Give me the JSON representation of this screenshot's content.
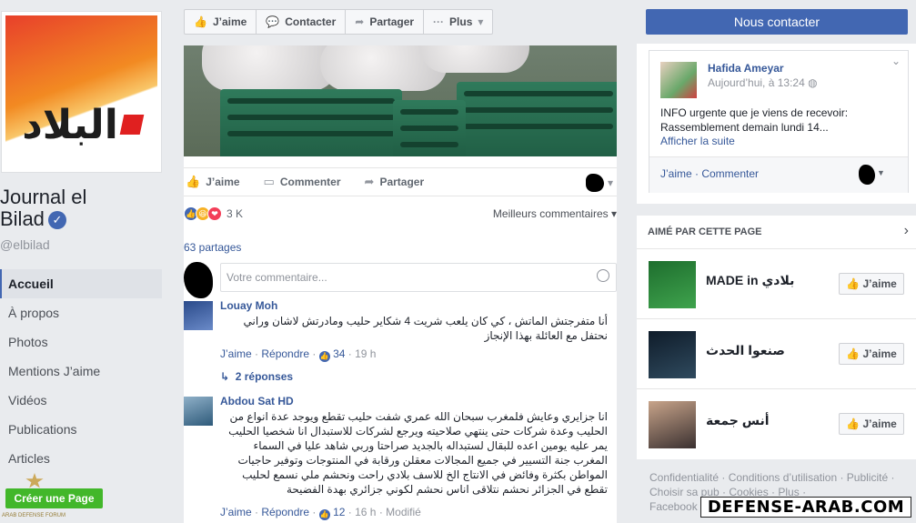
{
  "left": {
    "page_name_line1": "Journal el",
    "page_name_line2": "Bilad",
    "handle": "@elbilad",
    "logo_text": "البلاد",
    "nav": [
      "Accueil",
      "À propos",
      "Photos",
      "Mentions J’aime",
      "Vidéos",
      "Publications",
      "Articles"
    ],
    "create_page": "Créer une Page"
  },
  "action_bar": {
    "like": "J’aime",
    "contact": "Contacter",
    "share": "Partager",
    "more": "Plus"
  },
  "post": {
    "like": "J’aime",
    "comment": "Commenter",
    "share": "Partager",
    "reaction_count": "3 K",
    "best_comments": "Meilleurs commentaires",
    "shares": "63 partages",
    "comment_placeholder": "Votre commentaire..."
  },
  "comments": [
    {
      "name": "Louay Moh",
      "text": "أنا متفرجتش الماتش ، كي كان يلعب شريت 4 شكاير حليب ومادرتش لاشان وراني نحتفل مع العائلة بهذا الإنجاز",
      "like": "J’aime",
      "reply": "Répondre",
      "likes": "34",
      "time": "19 h",
      "replies": "2 réponses"
    },
    {
      "name": "Abdou Sat HD",
      "text": "انا جزايري وعايش فلمغرب سبحان الله عمري شفت حليب تقطع ويوجد عدة انواع من الحليب وعدة شركات حتى ينتهي صلاحيته ويرجع لشركات للاستبدال انا شخصيا الحليب يمر عليه يومين اعده للبقال لستبداله بالجديد صراحتا وربي شاهد عليا في السماء المغرب جنة التسيير في جميع المجالات معقلن ورقابة في المنتوجات وتوفير حاجيات المواطن بكثرة وفائض في الانتاج الخ للاسف بلادي راحت ونحشم ملي نسمع لحليب تقطع في الجزائر نحشم نتلاقى اناس نحشم لكوني جزائري بهدة الفضيحة",
      "like": "J’aime",
      "reply": "Répondre",
      "likes": "12",
      "time": "16 h",
      "modified": "Modifié"
    }
  ],
  "right": {
    "contact_button": "Nous contacter",
    "notif": {
      "name": "Hafida Ameyar",
      "time": "Aujourd’hui, à 13:24",
      "text": "INFO urgente que je viens de recevoir: Rassemblement demain lundi 14...",
      "more": "Afficher la suite",
      "actions": "J’aime · Commenter"
    },
    "liked_header": "AIMÉ PAR CETTE PAGE",
    "liked_items": [
      {
        "name": "MADE in بلادي",
        "button": "J’aime"
      },
      {
        "name": "صنعوا الحدث",
        "button": "J’aime"
      },
      {
        "name": "أنس جمعة",
        "button": "J’aime"
      }
    ],
    "footer": "Confidentialité · Conditions d’utilisation · Publicité · Choisir sa pub · Cookies · Plus ·",
    "footer2": "Facebook"
  },
  "watermark": "DEFENSE-ARAB.COM",
  "watermark_left": "ARAB DEFENSE FORUM",
  "colors": {
    "brand": "#4267b2",
    "link": "#365899",
    "green": "#42b72a",
    "background": "#e9ebee"
  }
}
